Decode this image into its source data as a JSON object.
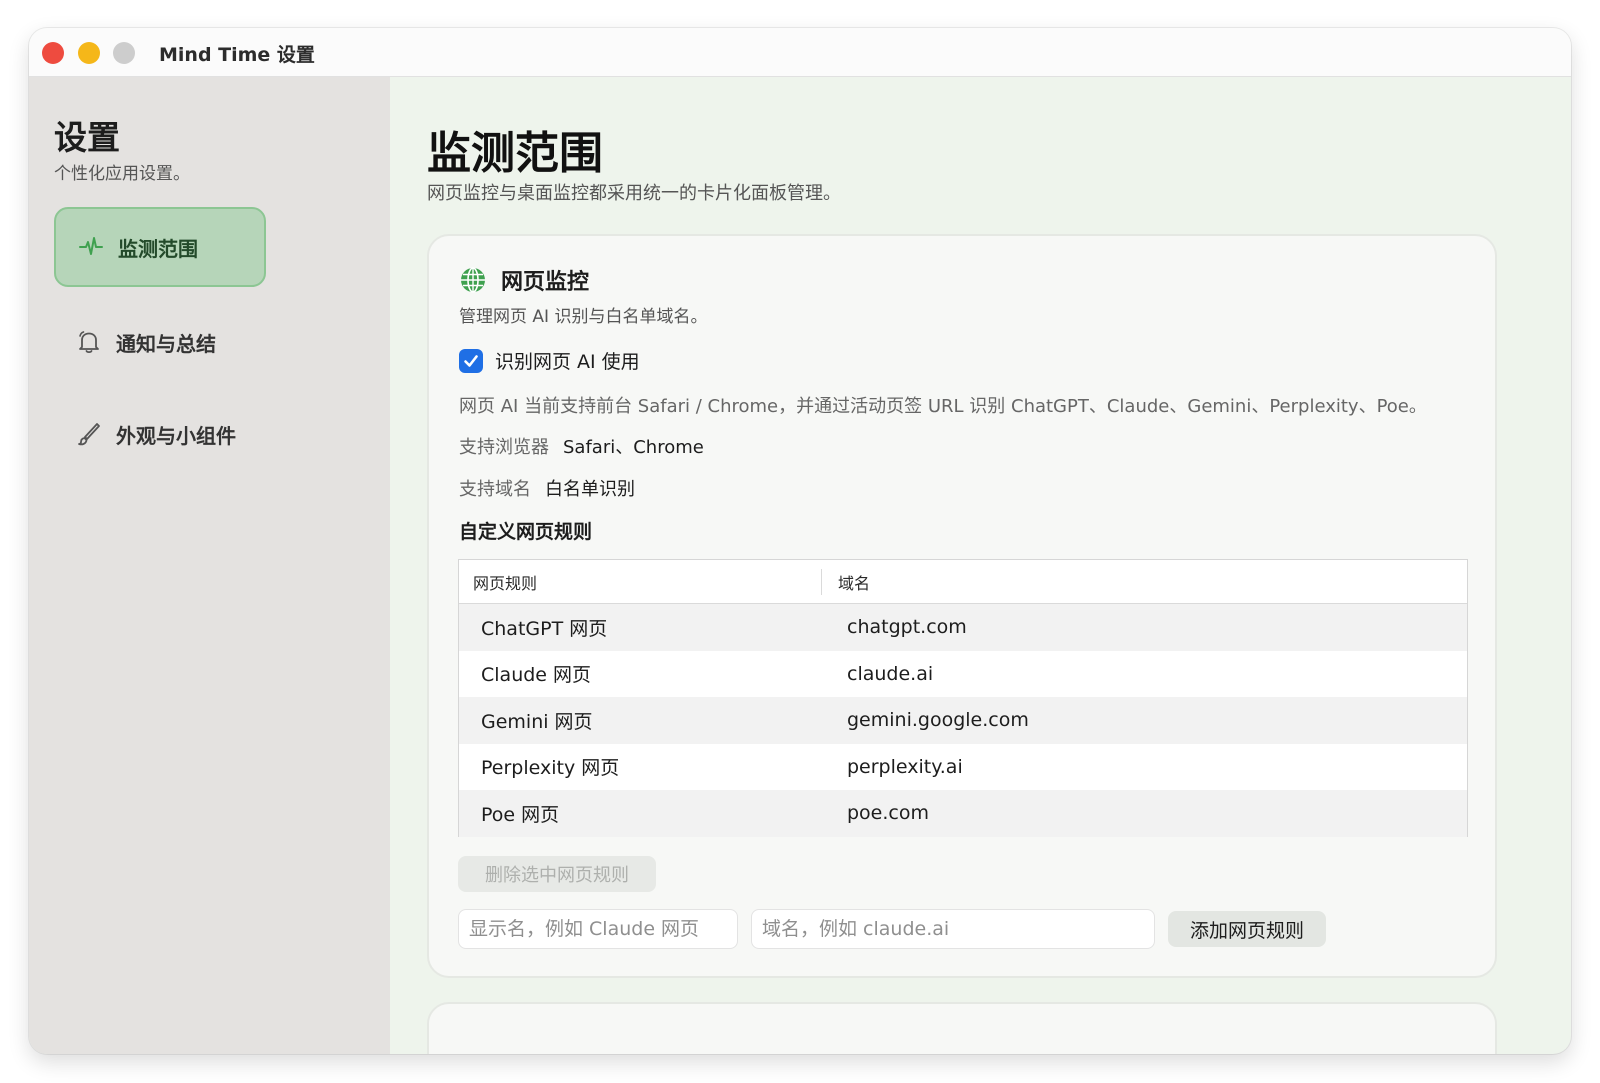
{
  "window": {
    "title": "Mind Time 设置"
  },
  "sidebar": {
    "title": "设置",
    "subtitle": "个性化应用设置。",
    "items": [
      {
        "label": "监测范围",
        "icon": "waveform-icon",
        "active": true
      },
      {
        "label": "通知与总结",
        "icon": "bell-icon",
        "active": false
      },
      {
        "label": "外观与小组件",
        "icon": "brush-icon",
        "active": false
      }
    ]
  },
  "main": {
    "title": "监测范围",
    "subtitle": "网页监控与桌面监控都采用统一的卡片化面板管理。",
    "web_card": {
      "icon": "globe-icon",
      "title": "网页监控",
      "subtitle": "管理网页 AI 识别与白名单域名。",
      "checkbox_label": "识别网页 AI 使用",
      "checkbox_checked": true,
      "note": "网页 AI 当前支持前台 Safari / Chrome，并通过活动页签 URL 识别 ChatGPT、Claude、Gemini、Perplexity、Poe。",
      "browsers_key": "支持浏览器",
      "browsers_value": "Safari、Chrome",
      "domains_key": "支持域名",
      "domains_value": "白名单识别",
      "rules_section": "自定义网页规则",
      "table": {
        "columns": [
          "网页规则",
          "域名"
        ],
        "rows": [
          {
            "rule": "ChatGPT 网页",
            "domain": "chatgpt.com"
          },
          {
            "rule": "Claude 网页",
            "domain": "claude.ai"
          },
          {
            "rule": "Gemini 网页",
            "domain": "gemini.google.com"
          },
          {
            "rule": "Perplexity 网页",
            "domain": "perplexity.ai"
          },
          {
            "rule": "Poe 网页",
            "domain": "poe.com"
          }
        ]
      },
      "delete_button": "删除选中网页规则",
      "name_input_placeholder": "显示名，例如 Claude 网页",
      "domain_input_placeholder": "域名，例如 claude.ai",
      "add_button": "添加网页规则"
    }
  },
  "colors": {
    "accent_green": "#3fa14f",
    "checkbox_blue": "#1f6fe5",
    "nav_active_bg": "#b6d5b9"
  }
}
